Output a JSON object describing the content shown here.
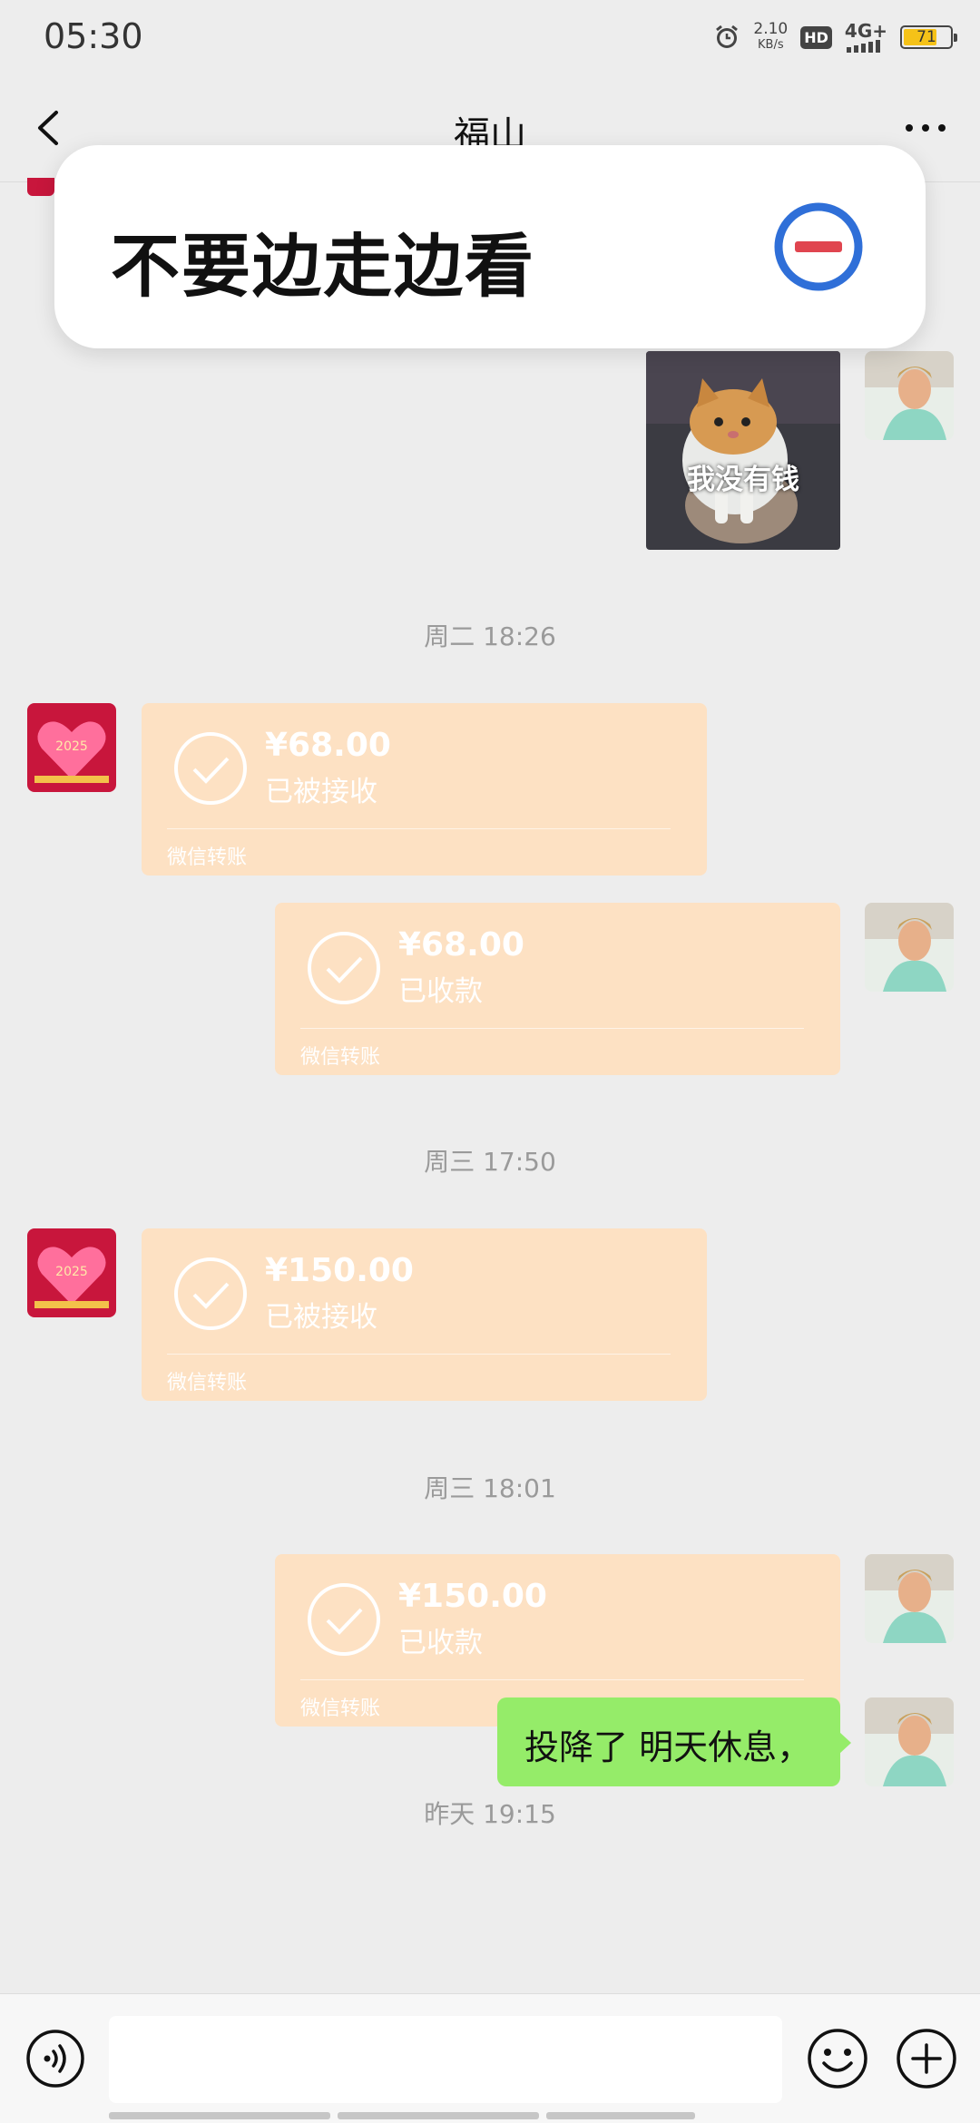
{
  "status_bar": {
    "time": "05:30",
    "speed_value": "2.10",
    "speed_unit": "KB/s",
    "hd": "HD",
    "network": "4G+",
    "battery": "71",
    "battery_level": 0.71
  },
  "header": {
    "title": "福山"
  },
  "banner": {
    "text": "不要边走边看"
  },
  "messages": {
    "sticker_caption": "我没有钱",
    "times": [
      "周二 18:26",
      "周三 17:50",
      "周三 18:01",
      "昨天 19:15"
    ],
    "transfers": [
      {
        "amount": "¥68.00",
        "status": "已被接收",
        "footer": "微信转账"
      },
      {
        "amount": "¥68.00",
        "status": "已收款",
        "footer": "微信转账"
      },
      {
        "amount": "¥150.00",
        "status": "已被接收",
        "footer": "微信转账"
      },
      {
        "amount": "¥150.00",
        "status": "已收款",
        "footer": "微信转账"
      }
    ],
    "last_text": "投降了 明天休息，"
  },
  "input": {
    "value": "",
    "placeholder": ""
  },
  "colors": {
    "background": "#ededed",
    "transfer_bg": "#fde1c3",
    "my_bubble": "#95ec69",
    "banner_icon_ring": "#2f6fd8",
    "banner_icon_bar": "#e0454f"
  },
  "icons": [
    "back-icon",
    "more-icon",
    "minus-circle-icon",
    "check-circle-icon",
    "voice-icon",
    "emoji-icon",
    "plus-icon",
    "alarm-icon",
    "signal-icon",
    "battery-icon"
  ]
}
